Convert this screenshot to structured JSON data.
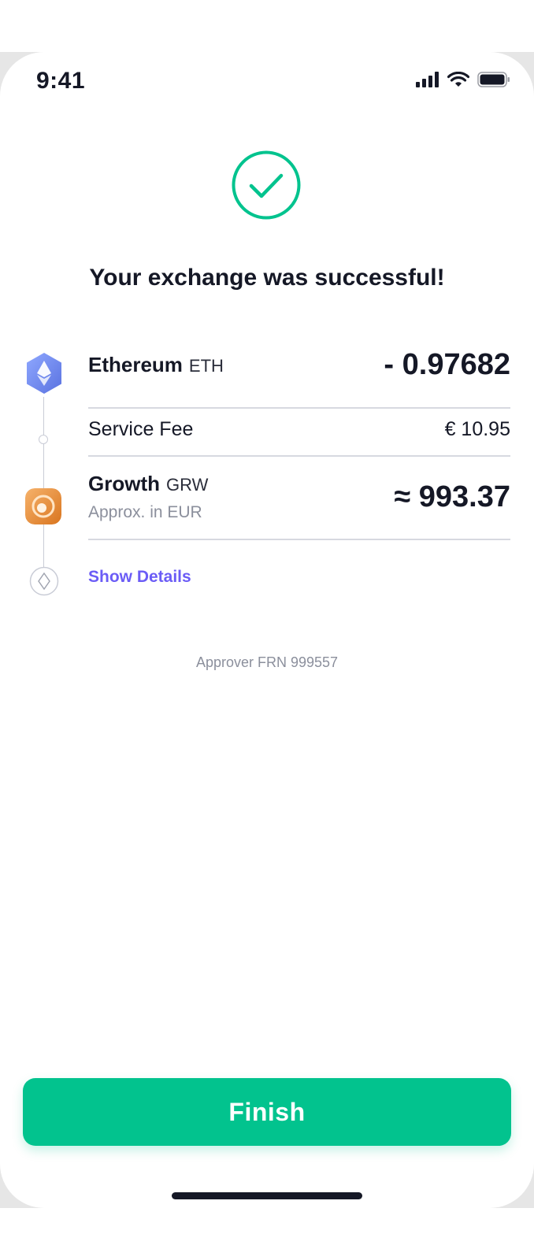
{
  "status_bar": {
    "time": "9:41"
  },
  "header": {
    "title": "Your exchange was successful!"
  },
  "exchange": {
    "from": {
      "name": "Ethereum",
      "ticker": "ETH",
      "amount": "- 0.97682",
      "icon": "ethereum-icon"
    },
    "fee": {
      "label": "Service Fee",
      "value": "€ 10.95"
    },
    "to": {
      "name": "Growth",
      "ticker": "GRW",
      "subtitle": "Approx. in EUR",
      "amount": "≈ 993.37",
      "icon": "growth-coin-icon"
    },
    "details_link": "Show Details"
  },
  "footer": {
    "approver": "Approver FRN 999557",
    "finish_label": "Finish"
  },
  "colors": {
    "accent": "#02c38e",
    "link": "#6b5cf6",
    "text": "#151826",
    "muted": "#8b8f9c"
  }
}
